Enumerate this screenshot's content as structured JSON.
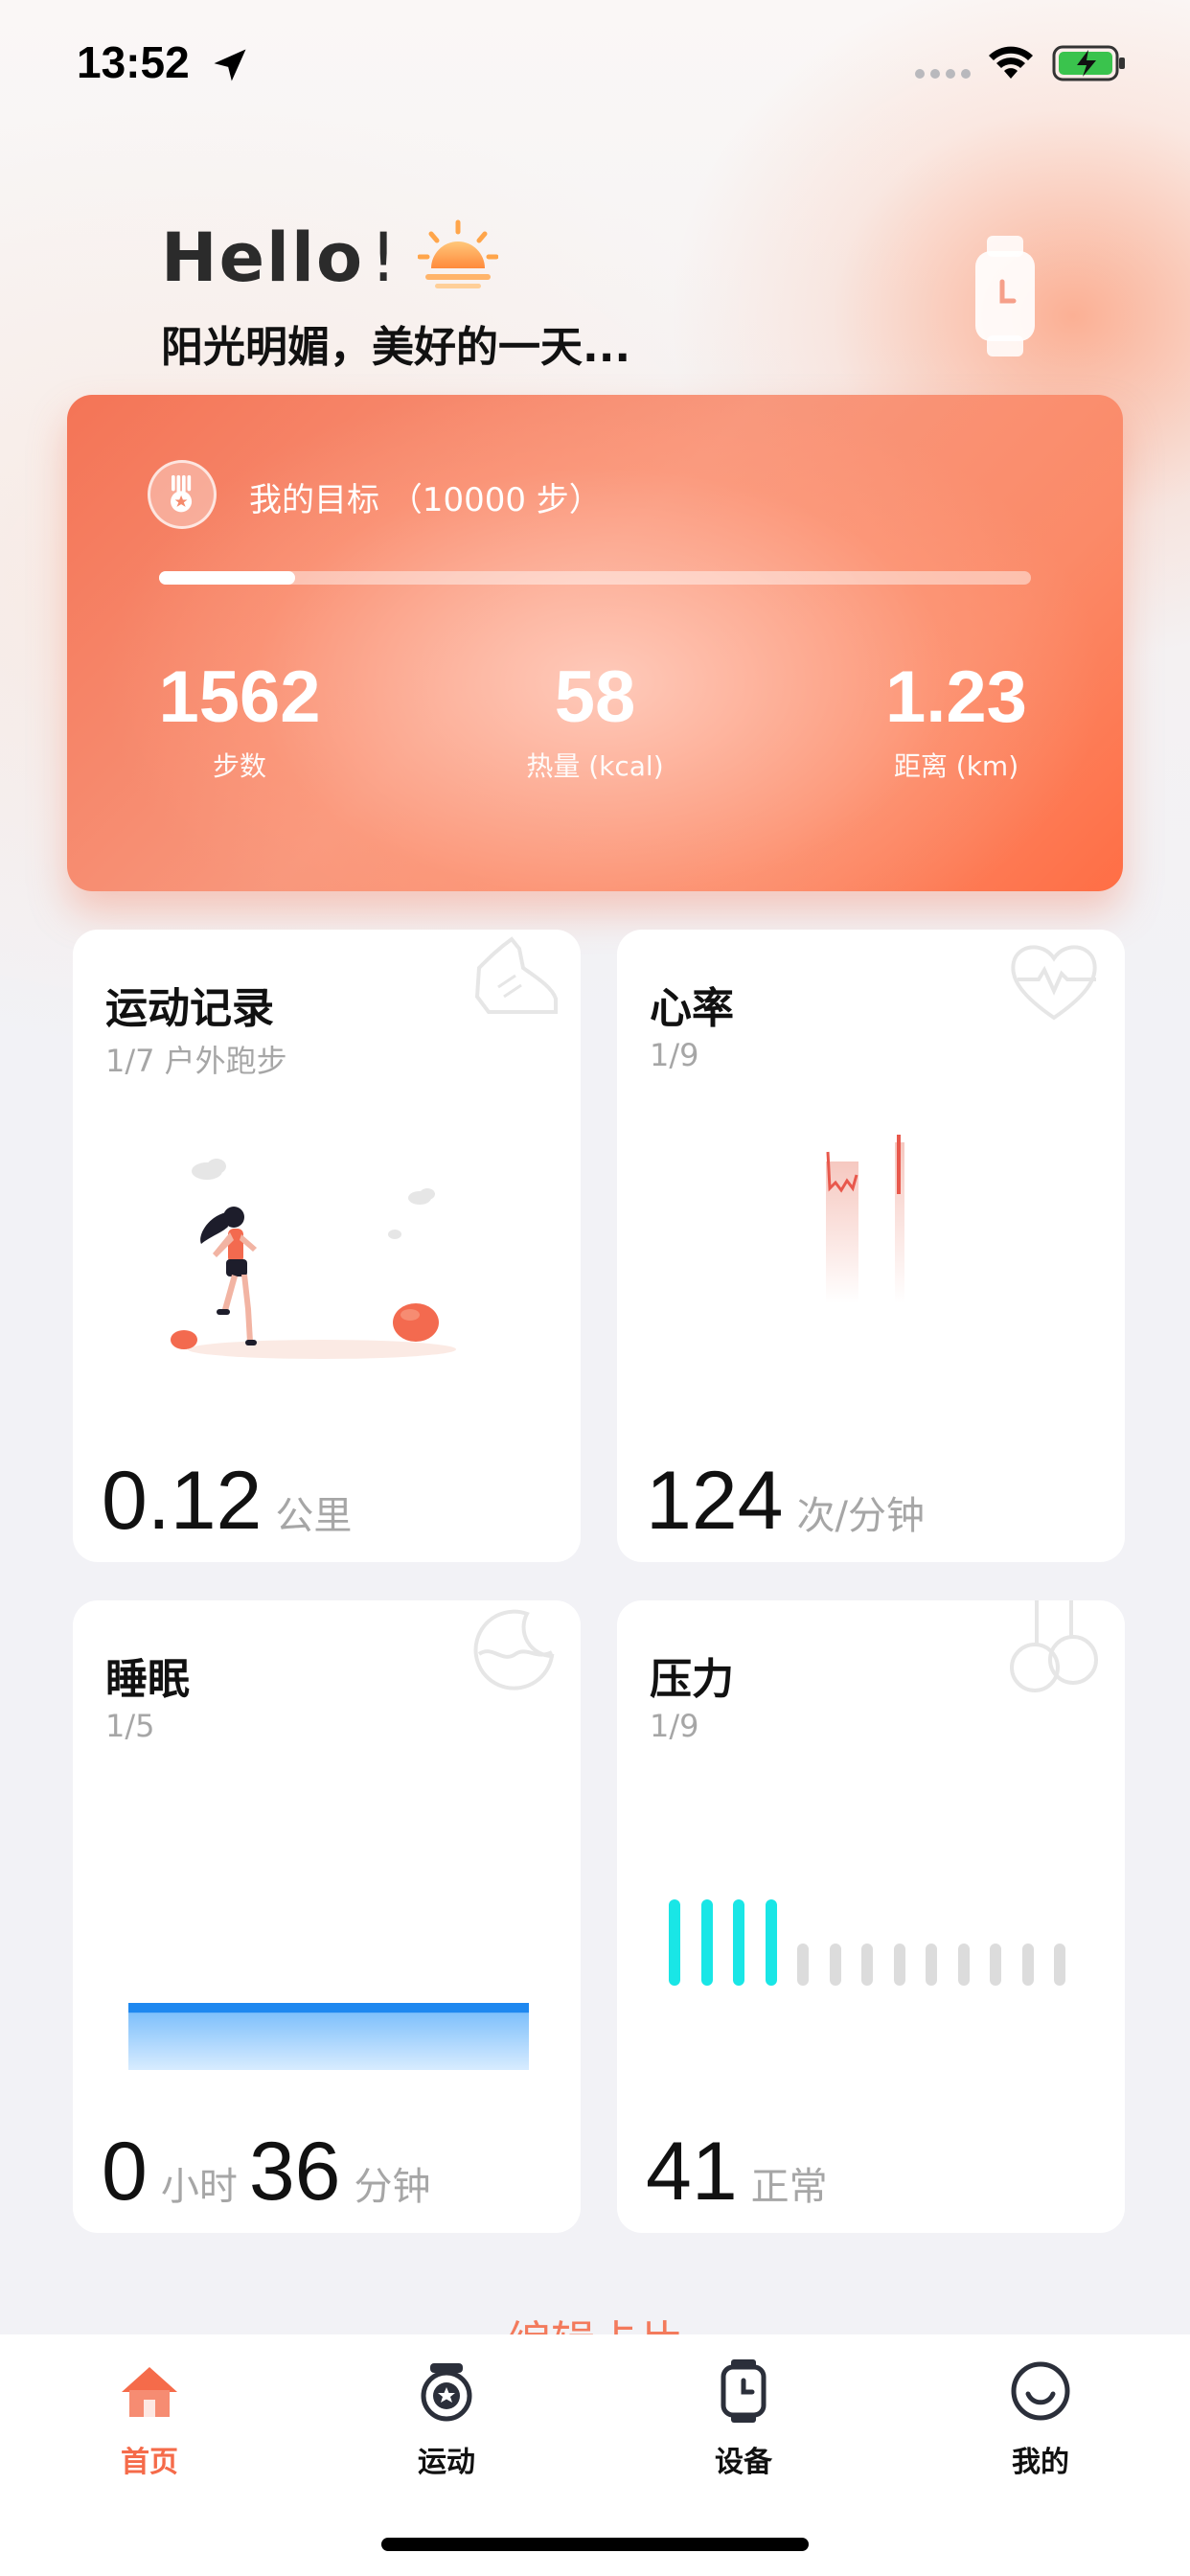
{
  "status_bar": {
    "time": "13:52"
  },
  "greeting": {
    "hello": "Hello",
    "exclaim": "!",
    "subtitle": "阳光明媚，美好的一天..."
  },
  "goal": {
    "label": "我的目标 （10000 步）",
    "progress": 0.156
  },
  "stats": [
    {
      "value": "1562",
      "label": "步数"
    },
    {
      "value": "58",
      "label": "热量 (kcal)"
    },
    {
      "value": "1.23",
      "label": "距离 (km)"
    }
  ],
  "cards": {
    "exercise": {
      "title": "运动记录",
      "sub": "1/7 户外跑步",
      "value": "0.12",
      "unit": "公里"
    },
    "heart": {
      "title": "心率",
      "sub": "1/9",
      "value": "124",
      "unit": "次/分钟"
    },
    "sleep": {
      "title": "睡眠",
      "sub": "1/5",
      "hours": "0",
      "hours_unit": "小时",
      "minutes": "36",
      "minutes_unit": "分钟"
    },
    "stress": {
      "title": "压力",
      "sub": "1/9",
      "value": "41",
      "unit": "正常",
      "active_bars": 4,
      "total_bars": 13
    }
  },
  "edit_cards": "编辑卡片",
  "nav": [
    {
      "label": "首页",
      "icon": "home-icon",
      "active": true
    },
    {
      "label": "运动",
      "icon": "sport-icon",
      "active": false
    },
    {
      "label": "设备",
      "icon": "watch-icon",
      "active": false
    },
    {
      "label": "我的",
      "icon": "smile-icon",
      "active": false
    }
  ],
  "colors": {
    "accent": "#f56b4a",
    "stress_active": "#19e6e6",
    "sleep_bar": "#1e88f0"
  }
}
